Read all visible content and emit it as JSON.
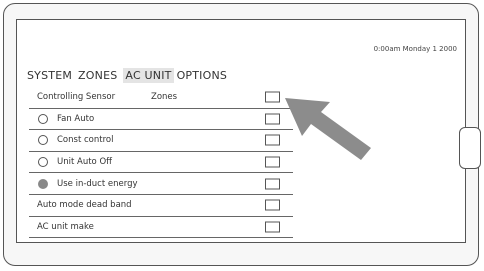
{
  "status": {
    "clock": "0:00am Monday 1  2000"
  },
  "tabs": [
    {
      "label": "SYSTEM",
      "active": false
    },
    {
      "label": "ZONES",
      "active": false
    },
    {
      "label": "AC UNIT",
      "active": true
    },
    {
      "label": "OPTIONS",
      "active": false
    }
  ],
  "rows": [
    {
      "label": "Controlling Sensor",
      "secondary": "Zones",
      "control": "none"
    },
    {
      "label": "Fan Auto",
      "control": "radio"
    },
    {
      "label": "Const control",
      "control": "radio"
    },
    {
      "label": "Unit Auto Off",
      "control": "radio"
    },
    {
      "label": "Use in-duct energy",
      "control": "radio-selected"
    },
    {
      "label": "Auto mode dead band",
      "control": "none"
    },
    {
      "label": "AC unit make",
      "control": "none"
    }
  ],
  "colors": {
    "accent_arrow": "#8c8c8c",
    "active_tab_bg": "#e4e4e4"
  },
  "icons": {
    "pointer": "arrow-pointer-icon",
    "hardware_button": "side-button"
  }
}
